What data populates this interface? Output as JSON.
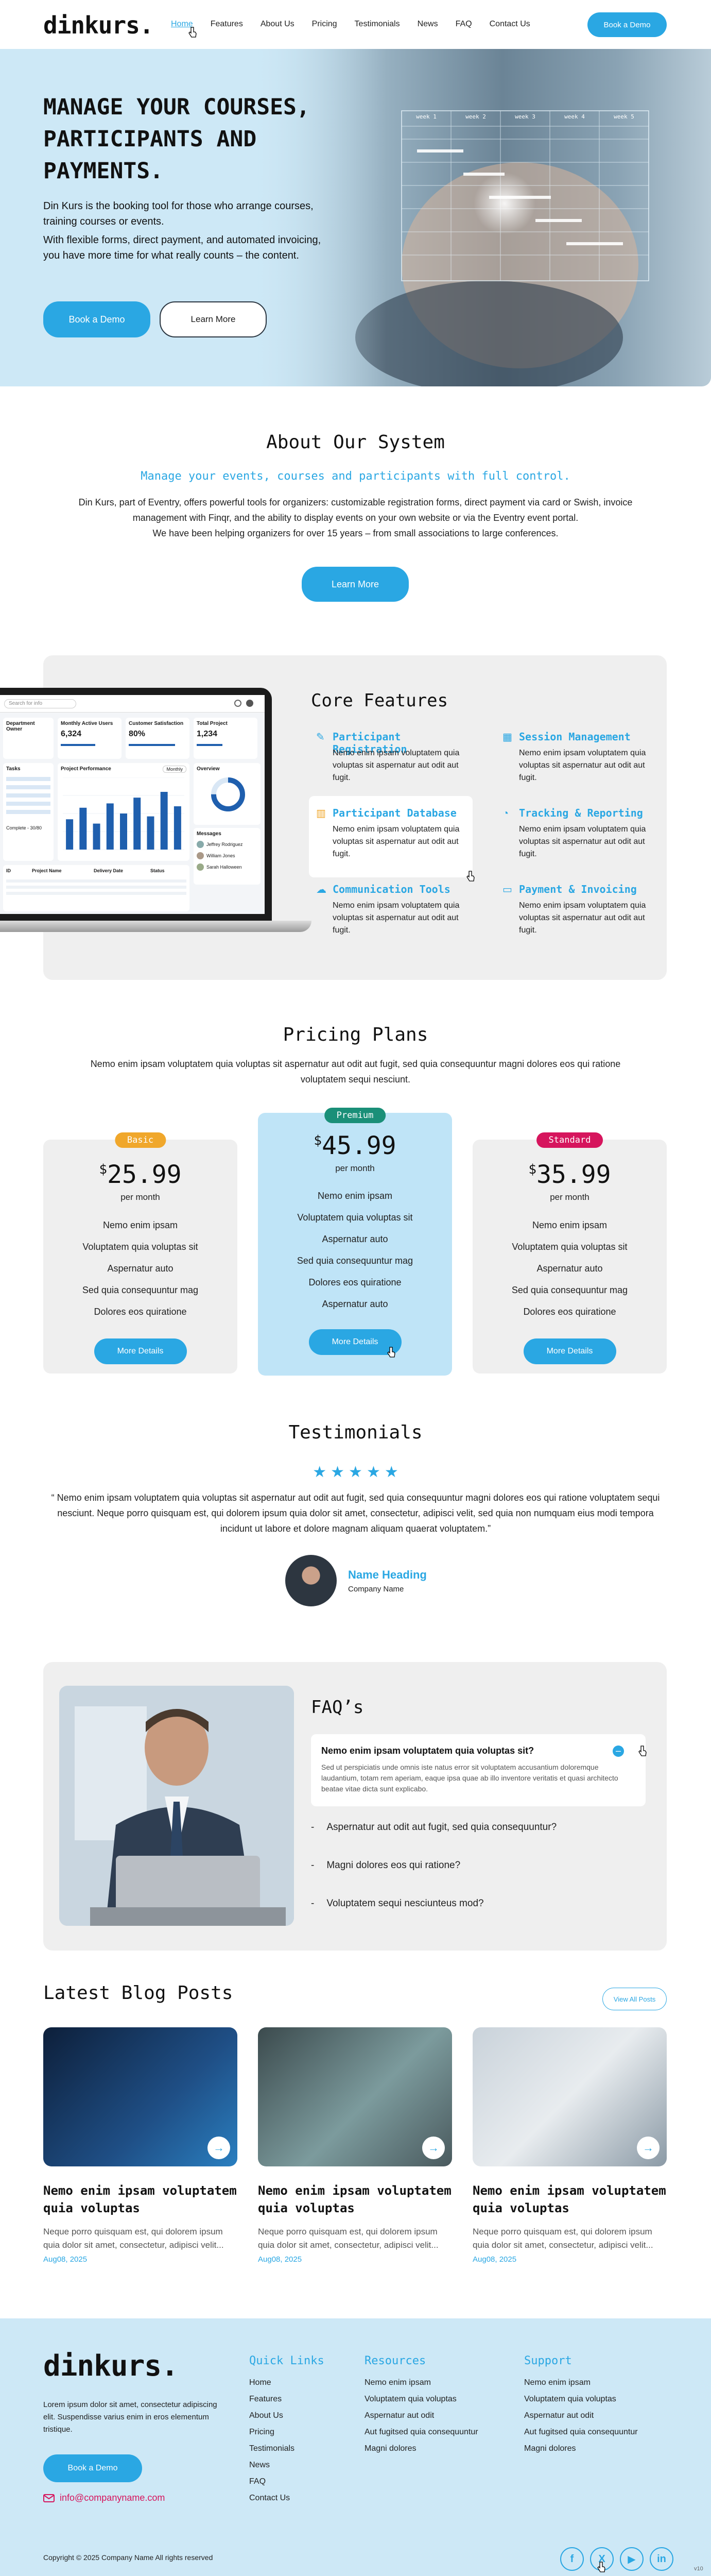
{
  "header": {
    "logo": "dinkurs.",
    "nav": [
      "Home",
      "Features",
      "About Us",
      "Pricing",
      "Testimonials",
      "News",
      "FAQ",
      "Contact Us"
    ],
    "cta": "Book a Demo"
  },
  "hero": {
    "title": "Manage your courses, participants and payments.",
    "p1": "Din Kurs is the booking tool for those who arrange courses, training courses or events.",
    "p2": "With flexible forms, direct payment, and automated invoicing, you have more time for what really counts – the content.",
    "btn_primary": "Book a Demo",
    "btn_secondary": "Learn More",
    "screen_cols": [
      "week 1",
      "week 2",
      "week 3",
      "week 4",
      "week 5"
    ]
  },
  "about": {
    "title": "About Our System",
    "subtitle": "Manage your events, courses and participants with full control.",
    "text1": "Din Kurs, part of Eventry, offers powerful tools for organizers: customizable registration forms, direct payment via card or Swish, invoice management with Finqr, and the ability to display events on your own website or via the Eventry event portal.",
    "text2": "We have been helping organizers for over 15 years – from small associations to large conferences.",
    "btn": "Learn More"
  },
  "dashboard": {
    "search": "Search for info",
    "side_title": "Department Owner",
    "kpis": [
      {
        "label": "Monthly Active Users",
        "value": "6,324"
      },
      {
        "label": "Customer Satisfaction",
        "value": "80%"
      },
      {
        "label": "Total Project",
        "value": "1,234"
      }
    ],
    "tasks_title": "Tasks",
    "perf_title": "Project Performance",
    "perf_filter": "Monthly",
    "overview_title": "Overview",
    "messages_title": "Messages",
    "message_names": [
      "Jeffrey Rodriguez",
      "William Jones",
      "Sarah Halloween"
    ],
    "bar_values": [
      42,
      58,
      36,
      64,
      50,
      72,
      46,
      80,
      60
    ],
    "completion": "Complete - 30/80",
    "table_headers": [
      "ID",
      "Project Name",
      "Delivery Date",
      "Status"
    ],
    "donut_percent": 75
  },
  "features": {
    "title": "Core Features",
    "items": [
      {
        "title": "Participant Registration",
        "icon": "edit-icon",
        "text": "Nemo enim ipsam voluptatem quia voluptas sit aspernatur aut odit aut fugit."
      },
      {
        "title": "Session Management",
        "icon": "calendar-icon",
        "text": "Nemo enim ipsam voluptatem quia voluptas sit aspernatur aut odit aut fugit."
      },
      {
        "title": "Participant Database",
        "icon": "bar-chart-icon",
        "text": "Nemo enim ipsam voluptatem quia voluptas sit aspernatur aut odit aut fugit."
      },
      {
        "title": "Tracking & Reporting",
        "icon": "pie-chart-icon",
        "text": "Nemo enim ipsam voluptatem quia voluptas sit aspernatur aut odit aut fugit."
      },
      {
        "title": "Communication Tools",
        "icon": "chat-icon",
        "text": "Nemo enim ipsam voluptatem quia voluptas sit aspernatur aut odit aut fugit."
      },
      {
        "title": "Payment & Invoicing",
        "icon": "credit-card-icon",
        "text": "Nemo enim ipsam voluptatem quia voluptas sit aspernatur aut odit aut fugit."
      }
    ]
  },
  "pricing": {
    "title": "Pricing Plans",
    "text": "Nemo enim ipsam voluptatem quia voluptas sit aspernatur aut odit aut fugit, sed quia consequuntur magni dolores eos qui ratione voluptatem sequi nesciunt.",
    "plans": [
      {
        "badge": "Basic",
        "currency": "$",
        "price": "25.99",
        "per": "per month",
        "features": [
          "Nemo enim ipsam",
          "Voluptatem quia voluptas sit",
          "Aspernatur auto",
          "Sed quia consequuntur mag",
          "Dolores eos quiratione"
        ],
        "btn": "More Details",
        "badge_color": "#f0a72b",
        "bg": "#efefef"
      },
      {
        "badge": "Premium",
        "currency": "$",
        "price": "45.99",
        "per": "per month",
        "features": [
          "Nemo enim ipsam",
          "Voluptatem quia voluptas sit",
          "Aspernatur auto",
          "Sed quia consequuntur mag",
          "Dolores eos quiratione",
          "Aspernatur auto"
        ],
        "btn": "More Details",
        "badge_color": "#1a8f78",
        "bg": "#bfe4f7"
      },
      {
        "badge": "Standard",
        "currency": "$",
        "price": "35.99",
        "per": "per month",
        "features": [
          "Nemo enim ipsam",
          "Voluptatem quia voluptas sit",
          "Aspernatur auto",
          "Sed quia consequuntur mag",
          "Dolores eos quiratione"
        ],
        "btn": "More Details",
        "badge_color": "#d6155d",
        "bg": "#efefef"
      }
    ]
  },
  "testimonials": {
    "title": "Testimonials",
    "rating": 5,
    "quote": "“ Nemo enim ipsam voluptatem quia voluptas sit aspernatur aut odit aut fugit, sed quia consequuntur magni dolores eos qui ratione voluptatem sequi nesciunt. Neque porro quisquam est, qui dolorem ipsum quia dolor sit amet, consectetur, adipisci velit, sed quia non numquam eius modi tempora incidunt ut labore et dolore magnam aliquam quaerat voluptatem.”",
    "name": "Name Heading",
    "role": "Company Name"
  },
  "faq": {
    "title": "FAQ’s",
    "open_q": "Nemo enim ipsam voluptatem quia voluptas sit?",
    "open_a": "Sed ut perspiciatis unde omnis iste natus error sit voluptatem accusantium doloremque laudantium, totam rem aperiam, eaque ipsa quae ab illo inventore veritatis et quasi architecto beatae vitae dicta sunt explicabo.",
    "items": [
      "Aspernatur aut odit aut fugit, sed quia consequuntur?",
      "Magni dolores eos qui ratione?",
      "Voluptatem sequi nesciunteus mod?"
    ]
  },
  "blog": {
    "title": "Latest Blog Posts",
    "view_all": "View All Posts",
    "posts": [
      {
        "title": "Nemo enim ipsam voluptatem quia voluptas",
        "text": "Neque porro quisquam est, qui dolorem ipsum quia dolor sit amet, consectetur, adipisci velit...",
        "date": "Aug08, 2025"
      },
      {
        "title": "Nemo enim ipsam voluptatem quia voluptas",
        "text": "Neque porro quisquam est, qui dolorem ipsum quia dolor sit amet, consectetur, adipisci velit...",
        "date": "Aug08, 2025"
      },
      {
        "title": "Nemo enim ipsam voluptatem quia voluptas",
        "text": "Neque porro quisquam est, qui dolorem ipsum quia dolor sit amet, consectetur, adipisci velit...",
        "date": "Aug08, 2025"
      }
    ]
  },
  "footer": {
    "logo": "dinkurs.",
    "about": "Lorem ipsum dolor sit amet, consectetur adipiscing elit. Suspendisse varius enim in eros elementum tristique.",
    "btn": "Book a Demo",
    "email": "info@companyname.com",
    "quick_title": "Quick Links",
    "quick": [
      "Home",
      "Features",
      "About Us",
      "Pricing",
      "Testimonials",
      "News",
      "FAQ",
      "Contact Us"
    ],
    "res_title": "Resources",
    "resources": [
      "Nemo enim ipsam",
      "Voluptatem quia voluptas",
      "Aspernatur aut odit",
      "Aut fugitsed quia consequuntur",
      "Magni dolores"
    ],
    "sup_title": "Support",
    "support": [
      "Nemo enim ipsam",
      "Voluptatem quia voluptas",
      "Aspernatur aut odit",
      "Aut fugitsed quia consequuntur",
      "Magni dolores"
    ],
    "copyright": "Copyright © 2025 Company Name All rights reserved",
    "socials": [
      {
        "icon": "facebook-icon",
        "glyph": "f"
      },
      {
        "icon": "x-icon",
        "glyph": "X"
      },
      {
        "icon": "youtube-icon",
        "glyph": "▶"
      },
      {
        "icon": "linkedin-icon",
        "glyph": "in"
      }
    ],
    "corner": "v10"
  },
  "colors": {
    "accent": "#2aa7e3",
    "hero_bg": "#cde8f6",
    "card_bg": "#efefef",
    "premium_bg": "#bfe4f7"
  }
}
